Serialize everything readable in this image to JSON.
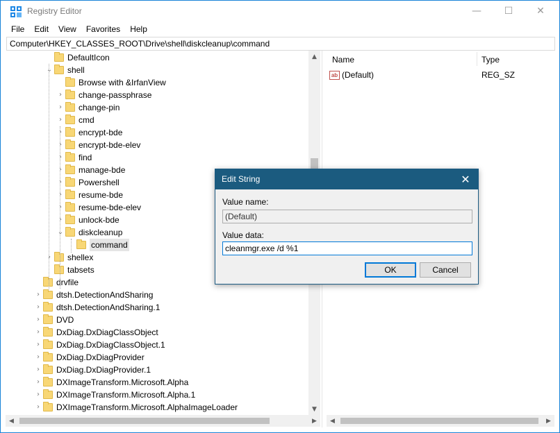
{
  "window": {
    "title": "Registry Editor",
    "minimize_glyph": "—",
    "maximize_glyph": "☐",
    "close_glyph": "✕"
  },
  "menu": [
    "File",
    "Edit",
    "View",
    "Favorites",
    "Help"
  ],
  "address": "Computer\\HKEY_CLASSES_ROOT\\Drive\\shell\\diskcleanup\\command",
  "tree": [
    {
      "label": "DefaultIcon",
      "chevron": "",
      "level": 2
    },
    {
      "label": "shell",
      "chevron": "⌄",
      "level": 2
    },
    {
      "label": "Browse with &IrfanView",
      "chevron": "",
      "level": 3
    },
    {
      "label": "change-passphrase",
      "chevron": "›",
      "level": 3
    },
    {
      "label": "change-pin",
      "chevron": "›",
      "level": 3
    },
    {
      "label": "cmd",
      "chevron": "›",
      "level": 3
    },
    {
      "label": "encrypt-bde",
      "chevron": "›",
      "level": 3
    },
    {
      "label": "encrypt-bde-elev",
      "chevron": "›",
      "level": 3
    },
    {
      "label": "find",
      "chevron": "›",
      "level": 3
    },
    {
      "label": "manage-bde",
      "chevron": "›",
      "level": 3
    },
    {
      "label": "Powershell",
      "chevron": "›",
      "level": 3
    },
    {
      "label": "resume-bde",
      "chevron": "›",
      "level": 3
    },
    {
      "label": "resume-bde-elev",
      "chevron": "›",
      "level": 3
    },
    {
      "label": "unlock-bde",
      "chevron": "›",
      "level": 3
    },
    {
      "label": "diskcleanup",
      "chevron": "⌄",
      "level": 3
    },
    {
      "label": "command",
      "chevron": "",
      "level": 4,
      "selected": true
    },
    {
      "label": "shellex",
      "chevron": "›",
      "level": 2
    },
    {
      "label": "tabsets",
      "chevron": "",
      "level": 2
    },
    {
      "label": "drvfile",
      "chevron": "",
      "level": 1
    },
    {
      "label": "dtsh.DetectionAndSharing",
      "chevron": "›",
      "level": 1
    },
    {
      "label": "dtsh.DetectionAndSharing.1",
      "chevron": "›",
      "level": 1
    },
    {
      "label": "DVD",
      "chevron": "›",
      "level": 1
    },
    {
      "label": "DxDiag.DxDiagClassObject",
      "chevron": "›",
      "level": 1
    },
    {
      "label": "DxDiag.DxDiagClassObject.1",
      "chevron": "›",
      "level": 1
    },
    {
      "label": "DxDiag.DxDiagProvider",
      "chevron": "›",
      "level": 1
    },
    {
      "label": "DxDiag.DxDiagProvider.1",
      "chevron": "›",
      "level": 1
    },
    {
      "label": "DXImageTransform.Microsoft.Alpha",
      "chevron": "›",
      "level": 1
    },
    {
      "label": "DXImageTransform.Microsoft.Alpha.1",
      "chevron": "›",
      "level": 1
    },
    {
      "label": "DXImageTransform.Microsoft.AlphaImageLoader",
      "chevron": "›",
      "level": 1
    }
  ],
  "list": {
    "columns": [
      "Name",
      "Type"
    ],
    "rows": [
      {
        "icon": "ab",
        "name": "(Default)",
        "type": "REG_SZ"
      }
    ]
  },
  "dialog": {
    "title": "Edit String",
    "close_glyph": "✕",
    "value_name_label": "Value name:",
    "value_name": "(Default)",
    "value_data_label": "Value data:",
    "value_data": "cleanmgr.exe /d %1",
    "ok_label": "OK",
    "cancel_label": "Cancel"
  },
  "scroll_glyphs": {
    "up": "▲",
    "down": "▼",
    "left": "◀",
    "right": "▶"
  }
}
